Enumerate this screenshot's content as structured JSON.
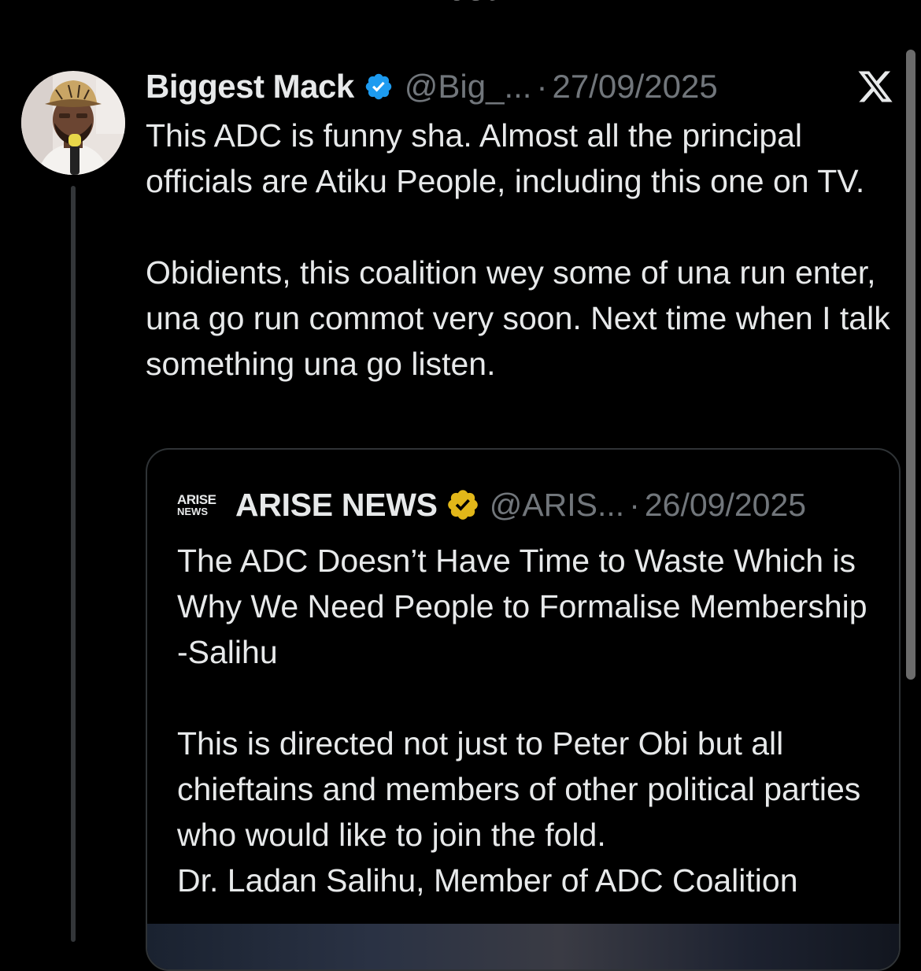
{
  "header": {
    "title": "Post"
  },
  "tweet": {
    "display_name": "Biggest Mack",
    "handle": "@Big_...",
    "separator": "·",
    "date": "27/09/2025",
    "paragraphs": [
      "This ADC is funny sha. Almost all the principal officials are Atiku People, including this one on TV.",
      "Obidients, this coalition wey some of una run enter, una go run commot very soon. Next time when I talk something una go listen."
    ]
  },
  "quote": {
    "logo_line1": "ARISE",
    "logo_line2": "NEWS",
    "display_name": "ARISE NEWS",
    "handle": "@ARIS...",
    "separator": "·",
    "date": "26/09/2025",
    "paragraphs": [
      "The ADC Doesn’t Have Time to Waste Which is Why We Need People to Formalise Membership -Salihu",
      "This is directed not just to Peter Obi but all chieftains and members of other political parties who would like to join the fold.",
      "Dr. Ladan Salihu, Member of ADC Coalition"
    ]
  },
  "icons": {
    "back": "chevron-left-icon",
    "verified_user": "verified-badge-blue-icon",
    "verified_org": "verified-badge-gold-icon",
    "brand": "x-logo-icon"
  },
  "colors": {
    "background": "#000000",
    "text": "#e7e9ea",
    "muted": "#71767b",
    "blue_check": "#1d9bf0",
    "gold_check": "#e2b719",
    "border": "#2f3336"
  }
}
